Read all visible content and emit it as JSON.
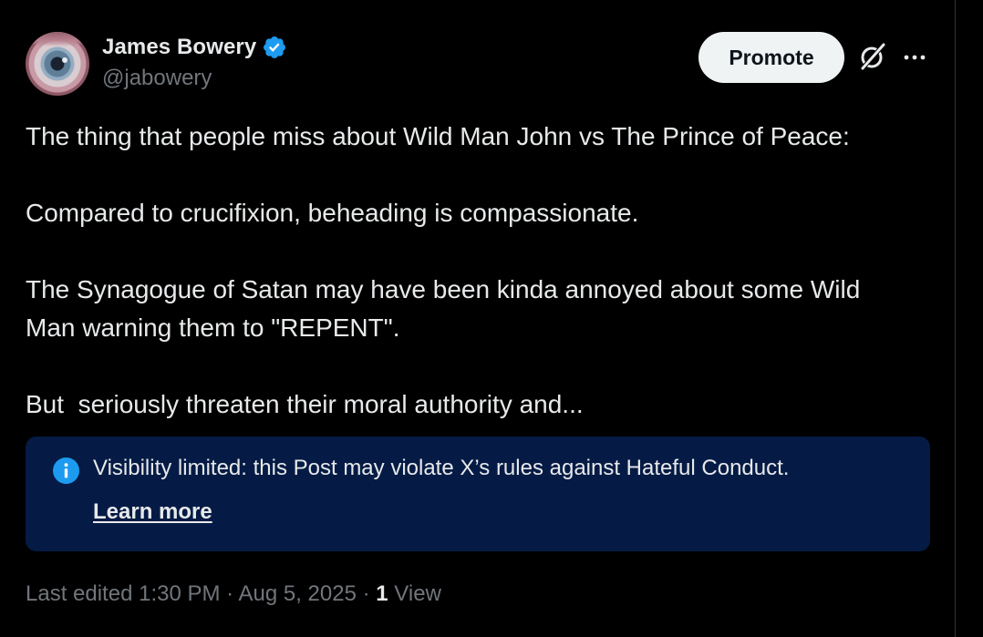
{
  "author": {
    "name": "James Bowery",
    "handle": "@jabowery",
    "verified": true,
    "verified_color": "#1d9bf0"
  },
  "actions": {
    "promote_label": "Promote",
    "grok_icon": "grok-icon",
    "more_icon": "more-icon"
  },
  "post": {
    "paragraphs": [
      "The thing that people miss about Wild Man John vs The Prince of Peace:",
      "Compared to crucifixion, beheading is compassionate.",
      "The Synagogue of Satan may have been kinda annoyed about some Wild\nMan warning them to \"REPENT\".",
      "But  seriously threaten their moral authority and..."
    ]
  },
  "notice": {
    "icon": "info-icon",
    "text": "Visibility limited: this Post may violate X’s rules against Hateful Conduct.",
    "link_label": "Learn more",
    "background": "#051b45",
    "icon_color": "#1d9bf0"
  },
  "meta": {
    "edited_prefix": "Last edited ",
    "time": "1:30 PM",
    "separator_1": " · ",
    "date": "Aug 5, 2025",
    "separator_2": " · ",
    "views_count": "1",
    "views_label": " View"
  },
  "colors": {
    "background": "#000000",
    "text_primary": "#e7e9ea",
    "text_secondary": "#71767b",
    "accent": "#1d9bf0"
  }
}
